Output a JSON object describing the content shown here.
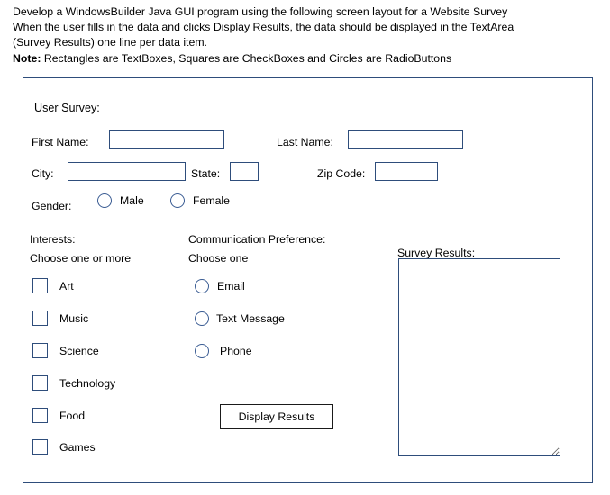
{
  "instructions": {
    "line1": "Develop a WindowsBuilder Java GUI program using the following screen layout for a Website Survey",
    "line2": "When the user fills in the data and clicks Display Results, the data should be displayed in the TextArea",
    "line3": "(Survey Results) one line per data item.",
    "note_label": "Note:",
    "note_text": " Rectangles are TextBoxes, Squares are CheckBoxes and Circles are RadioButtons"
  },
  "form": {
    "title": "User Survey:",
    "first_name_label": "First Name:",
    "first_name_value": "",
    "last_name_label": "Last Name:",
    "last_name_value": "",
    "city_label": "City:",
    "city_value": "",
    "state_label": "State:",
    "state_value": "",
    "zip_label": "Zip  Code:",
    "zip_value": "",
    "gender_label": "Gender:",
    "gender_options": [
      {
        "label": "Male",
        "selected": false
      },
      {
        "label": "Female",
        "selected": false
      }
    ],
    "interests_heading": "Interests:",
    "interests_subheading": "Choose one or more",
    "interests": [
      {
        "label": "Art",
        "checked": false
      },
      {
        "label": "Music",
        "checked": false
      },
      {
        "label": "Science",
        "checked": false
      },
      {
        "label": "Technology",
        "checked": false
      },
      {
        "label": "Food",
        "checked": false
      },
      {
        "label": "Games",
        "checked": false
      }
    ],
    "communication_heading": "Communication Preference:",
    "communication_subheading": "Choose one",
    "communication_options": [
      {
        "label": "Email",
        "selected": false
      },
      {
        "label": "Text Message",
        "selected": false
      },
      {
        "label": "Phone",
        "selected": false
      }
    ],
    "display_results_button": "Display Results",
    "survey_results_label": "Survey Results:",
    "survey_results_value": ""
  },
  "colors": {
    "control_border": "#2e4d7b",
    "button_border": "#1a1a1a",
    "text": "#000000",
    "background": "#ffffff"
  }
}
